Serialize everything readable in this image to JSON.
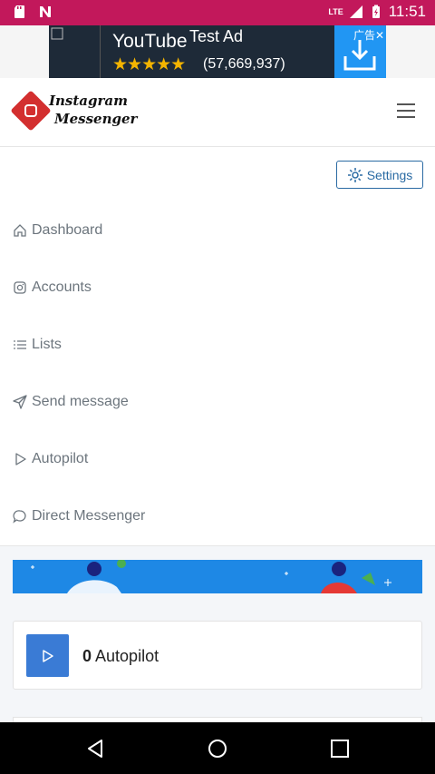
{
  "status_bar": {
    "network": "LTE",
    "time": "11:51",
    "bg_color": "#c2185b"
  },
  "ad": {
    "brand": "YouTube",
    "badge": "Test Ad",
    "stars": "★★★★★",
    "rating": "(57,669,937)",
    "label": "广告✕",
    "bg_color": "#1e2a38"
  },
  "header": {
    "logo_line1": "Instagram",
    "logo_line2": "Messenger"
  },
  "settings_button": {
    "label": "Settings"
  },
  "nav": [
    {
      "label": "Dashboard",
      "icon": "home-icon"
    },
    {
      "label": "Accounts",
      "icon": "instagram-icon"
    },
    {
      "label": "Lists",
      "icon": "list-icon"
    },
    {
      "label": "Send message",
      "icon": "send-icon"
    },
    {
      "label": "Autopilot",
      "icon": "play-icon"
    },
    {
      "label": "Direct Messenger",
      "icon": "chat-icon"
    }
  ],
  "autopilot_card": {
    "count": "0",
    "label": "Autopilot",
    "accent": "#3a7bd5"
  }
}
